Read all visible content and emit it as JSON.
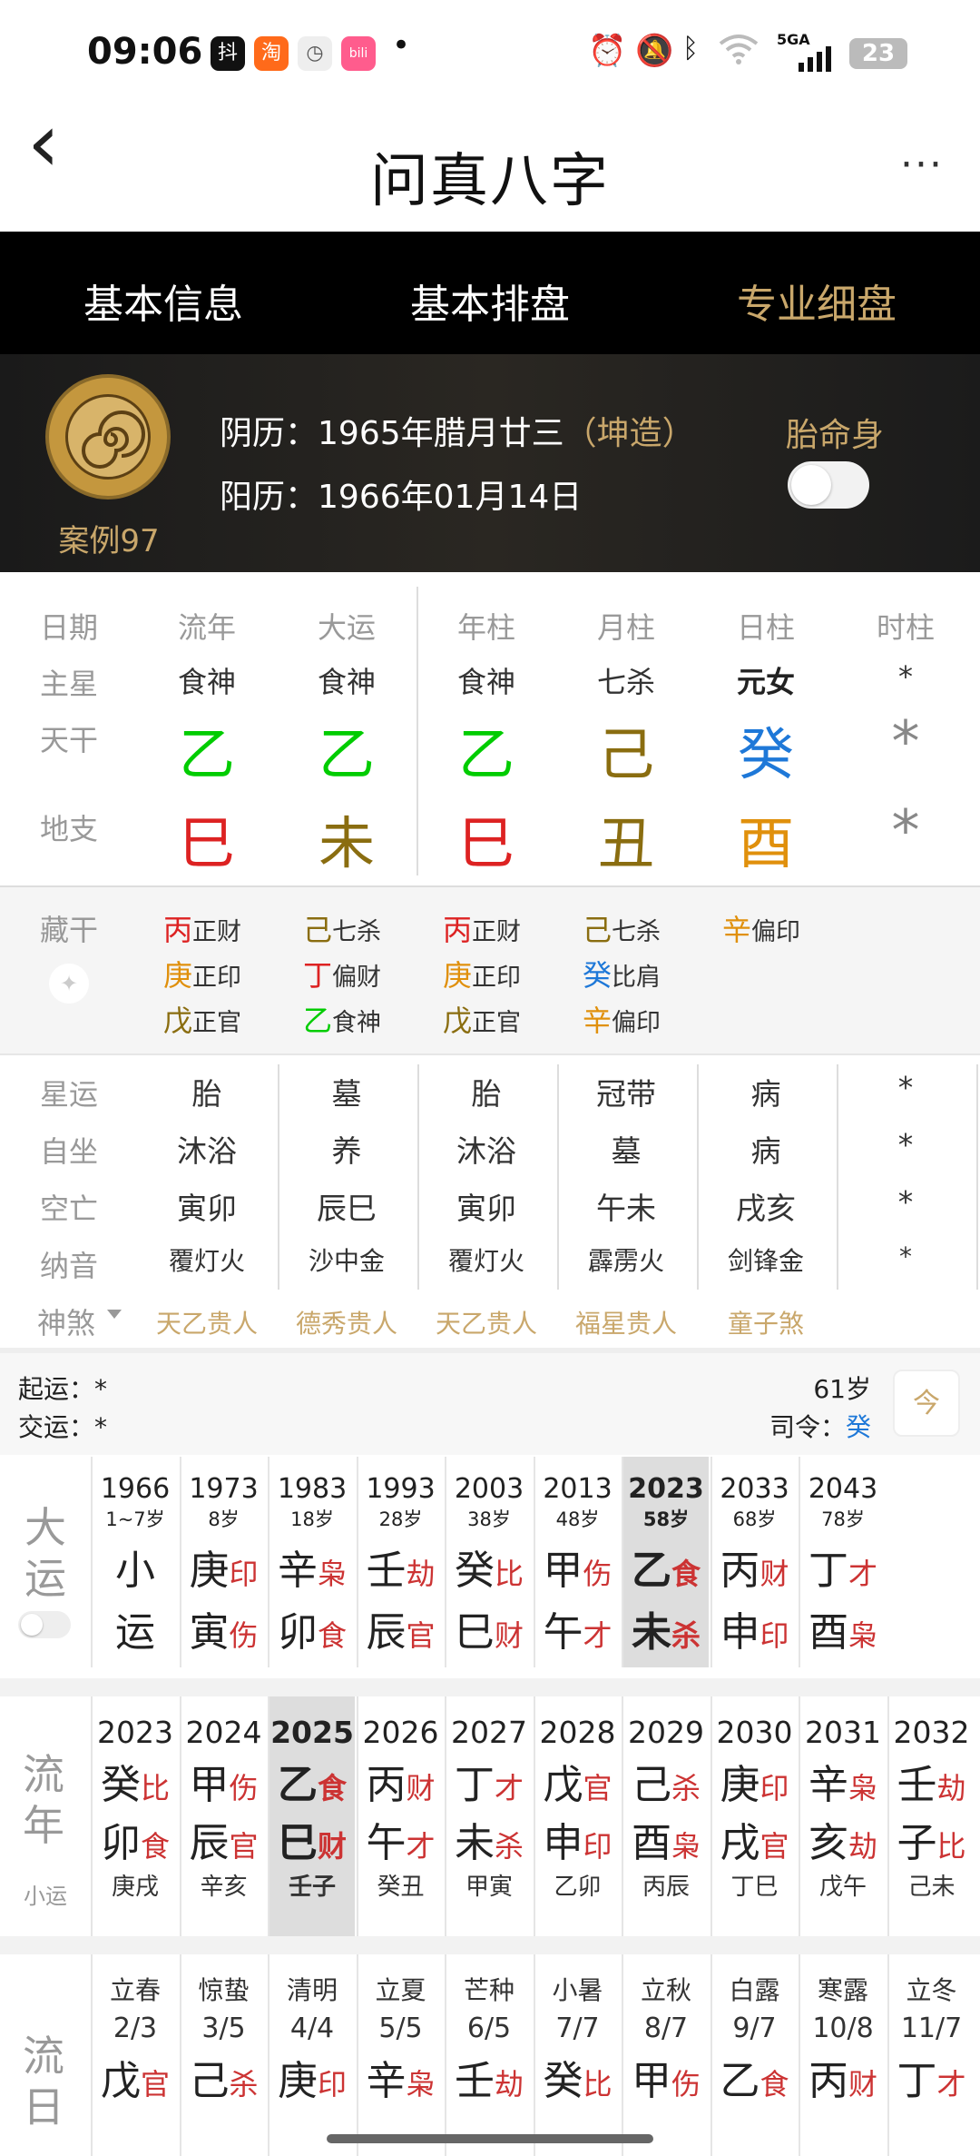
{
  "status": {
    "time": "09:06",
    "app_icons": [
      "抖",
      "淘",
      "◷",
      "bili"
    ],
    "dot": "•",
    "signal": "5GA",
    "battery": "23"
  },
  "header": {
    "title": "问真八字",
    "back": "‹",
    "more": "···"
  },
  "tabs": [
    "基本信息",
    "基本排盘",
    "专业细盘"
  ],
  "profile": {
    "case": "案例97",
    "lunar_prefix": "阴历：",
    "lunar": "1965年腊月廿三",
    "gender": "（坤造）",
    "solar_prefix": "阳历：",
    "solar": "1966年01月14日",
    "tms_label": "胎命身",
    "tms_on": false
  },
  "pillars": {
    "headers": [
      "日期",
      "流年",
      "大运",
      "年柱",
      "月柱",
      "日柱",
      "时柱"
    ],
    "main_star_label": "主星",
    "main_stars": [
      "食神",
      "食神",
      "食神",
      "七杀",
      "元女",
      "*"
    ],
    "tiangan_label": "天干",
    "tiangan": [
      "乙",
      "乙",
      "乙",
      "己",
      "癸",
      "*"
    ],
    "dizhi_label": "地支",
    "dizhi": [
      "巳",
      "未",
      "巳",
      "丑",
      "酉",
      "*"
    ]
  },
  "canggan": {
    "label": "藏干",
    "cols": [
      [
        [
          "丙",
          "正财"
        ],
        [
          "庚",
          "正印"
        ],
        [
          "戊",
          "正官"
        ]
      ],
      [
        [
          "己",
          "七杀"
        ],
        [
          "丁",
          "偏财"
        ],
        [
          "乙",
          "食神"
        ]
      ],
      [
        [
          "丙",
          "正财"
        ],
        [
          "庚",
          "正印"
        ],
        [
          "戊",
          "正官"
        ]
      ],
      [
        [
          "己",
          "七杀"
        ],
        [
          "癸",
          "比肩"
        ],
        [
          "辛",
          "偏印"
        ]
      ],
      [
        [
          "辛",
          "偏印"
        ]
      ]
    ]
  },
  "stars": {
    "labels": [
      "星运",
      "自坐",
      "空亡",
      "纳音"
    ],
    "rows": [
      [
        "胎",
        "墓",
        "胎",
        "冠带",
        "病",
        "*"
      ],
      [
        "沐浴",
        "养",
        "沐浴",
        "墓",
        "病",
        "*"
      ],
      [
        "寅卯",
        "辰巳",
        "寅卯",
        "午未",
        "戌亥",
        "*"
      ],
      [
        "覆灯火",
        "沙中金",
        "覆灯火",
        "霹雳火",
        "剑锋金",
        "*"
      ]
    ]
  },
  "shensha": {
    "label": "神煞",
    "items": [
      "天乙贵人",
      "德秀贵人",
      "天乙贵人",
      "福星贵人",
      "童子煞"
    ]
  },
  "luck_info": {
    "qiyun_label": "起运：",
    "qiyun": "*",
    "jiaoyun_label": "交运：",
    "jiaoyun": "*",
    "age": "61岁",
    "siling_label": "司令：",
    "siling": "癸",
    "today": "今"
  },
  "dayun": {
    "label": "大运",
    "cols": [
      {
        "year": "1966",
        "age": "1~7岁",
        "g": "小",
        "gs": "",
        "z": "运",
        "zs": ""
      },
      {
        "year": "1973",
        "age": "8岁",
        "g": "庚",
        "gs": "印",
        "z": "寅",
        "zs": "伤"
      },
      {
        "year": "1983",
        "age": "18岁",
        "g": "辛",
        "gs": "枭",
        "z": "卯",
        "zs": "食"
      },
      {
        "year": "1993",
        "age": "28岁",
        "g": "壬",
        "gs": "劫",
        "z": "辰",
        "zs": "官"
      },
      {
        "year": "2003",
        "age": "38岁",
        "g": "癸",
        "gs": "比",
        "z": "巳",
        "zs": "财"
      },
      {
        "year": "2013",
        "age": "48岁",
        "g": "甲",
        "gs": "伤",
        "z": "午",
        "zs": "才"
      },
      {
        "year": "2023",
        "age": "58岁",
        "g": "乙",
        "gs": "食",
        "z": "未",
        "zs": "杀"
      },
      {
        "year": "2033",
        "age": "68岁",
        "g": "丙",
        "gs": "财",
        "z": "申",
        "zs": "印"
      },
      {
        "year": "2043",
        "age": "78岁",
        "g": "丁",
        "gs": "才",
        "z": "酉",
        "zs": "枭"
      }
    ]
  },
  "liunian": {
    "label": "流年",
    "sub": "小运",
    "cols": [
      {
        "year": "2023",
        "g": "癸",
        "gs": "比",
        "z": "卯",
        "zs": "食",
        "x": "庚戌"
      },
      {
        "year": "2024",
        "g": "甲",
        "gs": "伤",
        "z": "辰",
        "zs": "官",
        "x": "辛亥"
      },
      {
        "year": "2025",
        "g": "乙",
        "gs": "食",
        "z": "巳",
        "zs": "财",
        "x": "壬子"
      },
      {
        "year": "2026",
        "g": "丙",
        "gs": "财",
        "z": "午",
        "zs": "才",
        "x": "癸丑"
      },
      {
        "year": "2027",
        "g": "丁",
        "gs": "才",
        "z": "未",
        "zs": "杀",
        "x": "甲寅"
      },
      {
        "year": "2028",
        "g": "戊",
        "gs": "官",
        "z": "申",
        "zs": "印",
        "x": "乙卯"
      },
      {
        "year": "2029",
        "g": "己",
        "gs": "杀",
        "z": "酉",
        "zs": "枭",
        "x": "丙辰"
      },
      {
        "year": "2030",
        "g": "庚",
        "gs": "印",
        "z": "戌",
        "zs": "官",
        "x": "丁巳"
      },
      {
        "year": "2031",
        "g": "辛",
        "gs": "枭",
        "z": "亥",
        "zs": "劫",
        "x": "戊午"
      },
      {
        "year": "2032",
        "g": "壬",
        "gs": "劫",
        "z": "子",
        "zs": "比",
        "x": "己未"
      }
    ]
  },
  "liuyue": {
    "label": "流日",
    "cols": [
      {
        "term": "立春",
        "date": "2/3",
        "g": "戊",
        "gs": "官"
      },
      {
        "term": "惊蛰",
        "date": "3/5",
        "g": "己",
        "gs": "杀"
      },
      {
        "term": "清明",
        "date": "4/4",
        "g": "庚",
        "gs": "印"
      },
      {
        "term": "立夏",
        "date": "5/5",
        "g": "辛",
        "gs": "枭"
      },
      {
        "term": "芒种",
        "date": "6/5",
        "g": "壬",
        "gs": "劫"
      },
      {
        "term": "小暑",
        "date": "7/7",
        "g": "癸",
        "gs": "比"
      },
      {
        "term": "立秋",
        "date": "8/7",
        "g": "甲",
        "gs": "伤"
      },
      {
        "term": "白露",
        "date": "9/7",
        "g": "乙",
        "gs": "食"
      },
      {
        "term": "寒露",
        "date": "10/8",
        "g": "丙",
        "gs": "财"
      },
      {
        "term": "立冬",
        "date": "11/7",
        "g": "丁",
        "gs": "才"
      }
    ]
  }
}
